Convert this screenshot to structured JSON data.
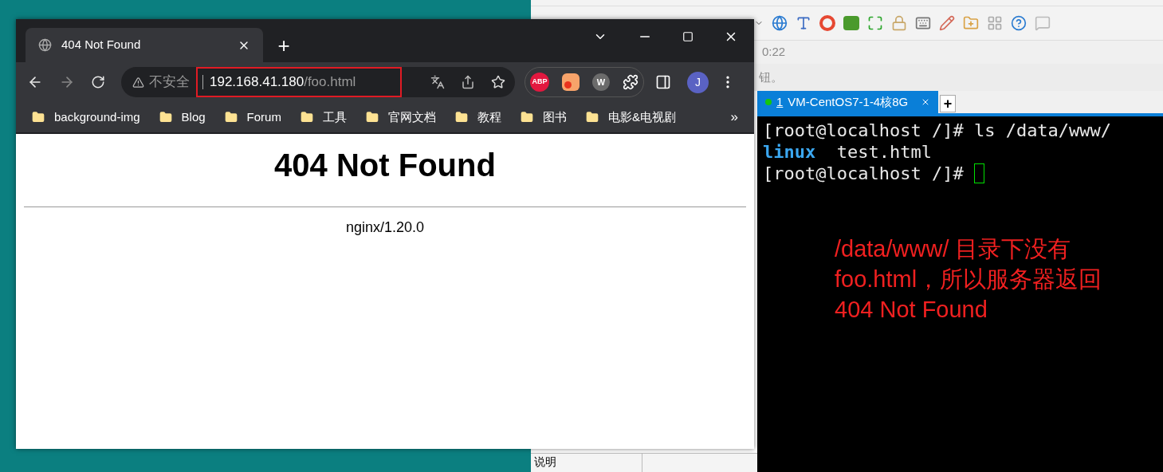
{
  "browser": {
    "tabs": [
      {
        "title": "404 Not Found",
        "selected": true
      }
    ],
    "new_tab": "+",
    "address_bar": {
      "security_label": "不安全",
      "host": "192.168.41.180",
      "path": "/foo.html"
    },
    "extensions": [
      {
        "kind": "abp",
        "label": "ABP"
      },
      {
        "kind": "feed"
      },
      {
        "kind": "w",
        "label": "W"
      }
    ],
    "profile_initial": "J",
    "bookmarks": [
      {
        "title": "background-img"
      },
      {
        "title": "Blog"
      },
      {
        "title": "Forum"
      },
      {
        "title": "工具"
      },
      {
        "title": "官网文档"
      },
      {
        "title": "教程"
      },
      {
        "title": "图书"
      },
      {
        "title": "电影&电视剧"
      }
    ],
    "bookmarks_more": "»",
    "page": {
      "heading": "404 Not Found",
      "footer": "nginx/1.20.0"
    }
  },
  "terminal_app": {
    "status_text": "0:22",
    "hint_text": "钮。",
    "tabs": [
      {
        "number": "1",
        "title": "VM-CentOS7-1-4核8G",
        "selected": true,
        "connected": true
      }
    ],
    "new_tab": "+",
    "terminal_lines": [
      {
        "segments": [
          {
            "kind": "plain",
            "text": "[root@localhost /]# ls /data/www/"
          }
        ],
        "cursor": false
      },
      {
        "segments": [
          {
            "kind": "directory",
            "text": "linux"
          },
          {
            "kind": "plain",
            "text": "  test.html"
          }
        ],
        "cursor": false
      },
      {
        "segments": [
          {
            "kind": "plain",
            "text": "[root@localhost /]# "
          }
        ],
        "cursor": true
      }
    ],
    "side_panel": {
      "label": "说明"
    }
  },
  "annotation": {
    "lines": [
      "/data/www/ 目录下没有",
      "foo.html，所以服务器返回",
      "404 Not Found"
    ]
  }
}
